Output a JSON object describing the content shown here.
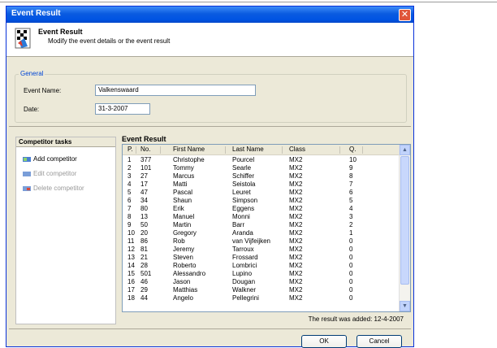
{
  "window": {
    "title": "Event Result"
  },
  "header": {
    "title": "Event Result",
    "subtitle": "Modify the event details or the event result"
  },
  "general": {
    "legend": "General",
    "event_name_label": "Event Name:",
    "event_name_value": "Valkenswaard",
    "date_label": "Date:",
    "date_value": "31-3-2007"
  },
  "tasks": {
    "header": "Competitor tasks",
    "items": [
      {
        "label": "Add competitor",
        "enabled": true
      },
      {
        "label": "Edit competitor",
        "enabled": false
      },
      {
        "label": "Delete competitor",
        "enabled": false
      }
    ]
  },
  "result": {
    "title": "Event Result",
    "columns": [
      "P.",
      "No.",
      "First Name",
      "Last Name",
      "Class",
      "Q."
    ],
    "rows": [
      [
        "1",
        "377",
        "Christophe",
        "Pourcel",
        "MX2",
        "10"
      ],
      [
        "2",
        "101",
        "Tommy",
        "Searle",
        "MX2",
        "9"
      ],
      [
        "3",
        "27",
        "Marcus",
        "Schiffer",
        "MX2",
        "8"
      ],
      [
        "4",
        "17",
        "Matti",
        "Seistola",
        "MX2",
        "7"
      ],
      [
        "5",
        "47",
        "Pascal",
        "Leuret",
        "MX2",
        "6"
      ],
      [
        "6",
        "34",
        "Shaun",
        "Simpson",
        "MX2",
        "5"
      ],
      [
        "7",
        "80",
        "Erik",
        "Eggens",
        "MX2",
        "4"
      ],
      [
        "8",
        "13",
        "Manuel",
        "Monni",
        "MX2",
        "3"
      ],
      [
        "9",
        "50",
        "Martin",
        "Barr",
        "MX2",
        "2"
      ],
      [
        "10",
        "20",
        "Gregory",
        "Aranda",
        "MX2",
        "1"
      ],
      [
        "11",
        "86",
        "Rob",
        "van Vijfeijken",
        "MX2",
        "0"
      ],
      [
        "12",
        "81",
        "Jeremy",
        "Tarroux",
        "MX2",
        "0"
      ],
      [
        "13",
        "21",
        "Steven",
        "Frossard",
        "MX2",
        "0"
      ],
      [
        "14",
        "28",
        "Roberto",
        "Lombrici",
        "MX2",
        "0"
      ],
      [
        "15",
        "501",
        "Alessandro",
        "Lupino",
        "MX2",
        "0"
      ],
      [
        "16",
        "46",
        "Jason",
        "Dougan",
        "MX2",
        "0"
      ],
      [
        "17",
        "29",
        "Matthias",
        "Walkner",
        "MX2",
        "0"
      ],
      [
        "18",
        "44",
        "Angelo",
        "Pellegrini",
        "MX2",
        "0"
      ]
    ],
    "added_text": "The result was added: 12-4-2007"
  },
  "buttons": {
    "ok": "OK",
    "cancel": "Cancel"
  },
  "colors": {
    "titlebar": "#0054e3",
    "accent": "#0046d5",
    "dialog_bg": "#ece9d8"
  }
}
